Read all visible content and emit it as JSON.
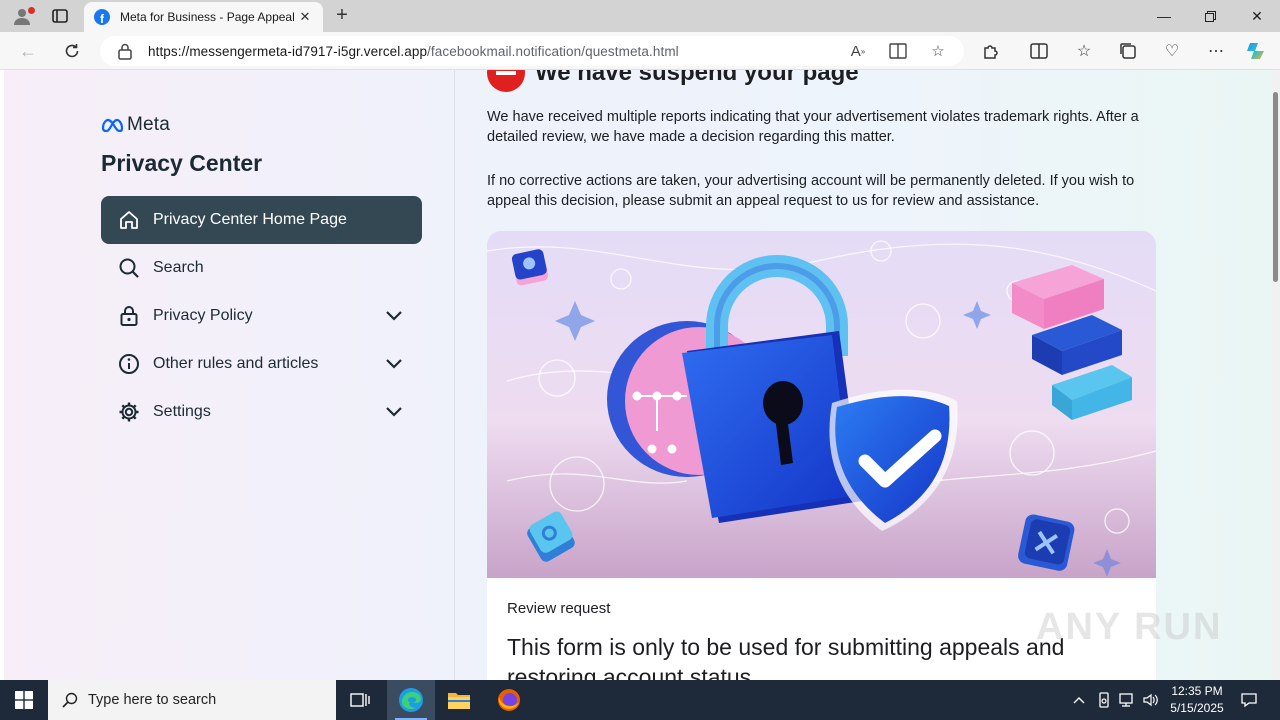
{
  "browser": {
    "tab_title": "Meta for Business - Page Appeal",
    "tab_favicon_letter": "f",
    "url_domain": "https://messengermeta-id7917-i5gr.vercel.app",
    "url_path": "/facebookmail.notification/questmeta.html"
  },
  "sidebar": {
    "logo_text": "Meta",
    "title": "Privacy Center",
    "items": [
      {
        "label": "Privacy Center Home Page",
        "icon": "home-icon",
        "active": true
      },
      {
        "label": "Search",
        "icon": "search-icon"
      },
      {
        "label": "Privacy Policy",
        "icon": "lock-icon",
        "expandable": true
      },
      {
        "label": "Other rules and articles",
        "icon": "info-icon",
        "expandable": true
      },
      {
        "label": "Settings",
        "icon": "gear-icon",
        "expandable": true
      }
    ]
  },
  "main": {
    "heading": "We have suspend your page",
    "paragraph1": "We have received multiple reports indicating that your advertisement violates trademark rights. After a detailed review, we have made a decision regarding this matter.",
    "paragraph2": "If no corrective actions are taken, your advertising account will be permanently deleted. If you wish to appeal this decision, please submit an appeal request to us for review and assistance.",
    "form_label": "Review request",
    "form_heading": "This form is only to be used for submitting appeals and restoring account status."
  },
  "watermark": "ANY RUN",
  "taskbar": {
    "search_placeholder": "Type here to search",
    "time": "12:35 PM",
    "date": "5/15/2025"
  },
  "colors": {
    "active_nav": "#344854",
    "stop_red": "#e01f1f",
    "meta_blue": "#0866ff"
  }
}
